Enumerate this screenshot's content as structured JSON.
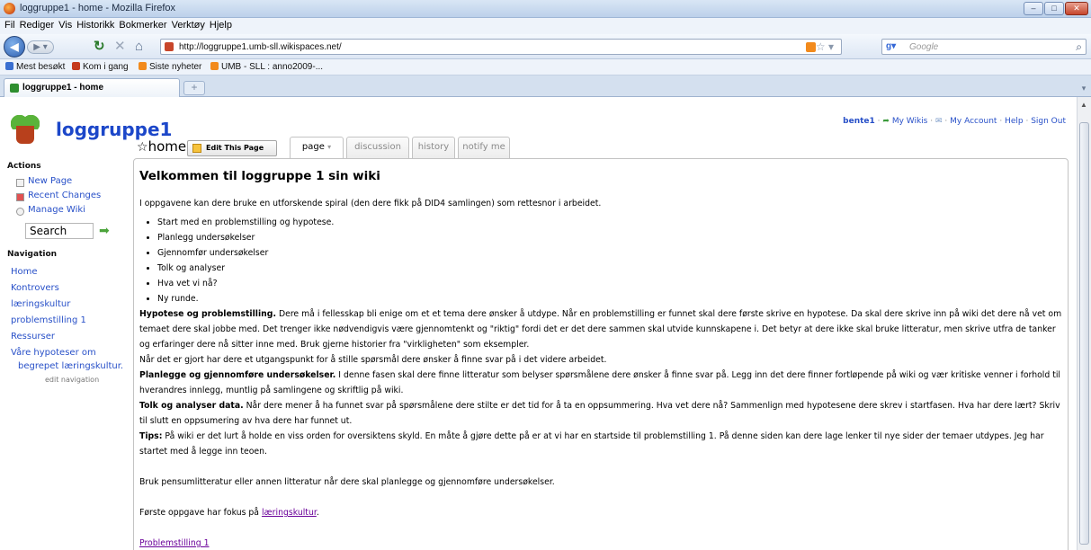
{
  "window": {
    "title": "loggruppe1 - home - Mozilla Firefox",
    "buttons": [
      "–",
      "□",
      "✕"
    ]
  },
  "menu": [
    "Fil",
    "Rediger",
    "Vis",
    "Historikk",
    "Bokmerker",
    "Verktøy",
    "Hjelp"
  ],
  "nav": {
    "url": "http://loggruppe1.umb-sll.wikispaces.net/",
    "search_placeholder": "Google"
  },
  "bookmarks": [
    {
      "label": "Mest besøkt",
      "color": "#3a6fd0"
    },
    {
      "label": "Kom i gang",
      "color": "#c5391c"
    },
    {
      "label": "Siste nyheter",
      "color": "#f28a1c"
    },
    {
      "label": "UMB - SLL : anno2009-...",
      "color": "#f28a1c"
    }
  ],
  "tab": {
    "label": "loggruppe1 - home"
  },
  "site": {
    "name": "loggruppe1",
    "user": "bente1",
    "userlinks": [
      "My Wikis",
      "My Account",
      "Help",
      "Sign Out"
    ]
  },
  "page": {
    "name": "home",
    "edit_label": "Edit This Page",
    "tabs": [
      "page",
      "discussion",
      "history",
      "notify me"
    ]
  },
  "sidebar": {
    "actions_heading": "Actions",
    "actions": [
      "New Page",
      "Recent Changes",
      "Manage Wiki"
    ],
    "search_label": "Search",
    "navigation_heading": "Navigation",
    "nav_links": [
      "Home",
      "Kontrovers",
      "læringskultur",
      "problemstilling 1",
      "Ressurser",
      "Våre hypoteser om",
      "begrepet læringskultur."
    ],
    "edit_navigation": "edit navigation"
  },
  "content": {
    "heading": "Velkommen til loggruppe 1 sin wiki",
    "intro": "I oppgavene kan dere bruke en utforskende spiral (den dere fikk på DID4 samlingen) som rettesnor i arbeidet.",
    "steps": [
      "Start med en problemstilling og hypotese.",
      "Planlegg undersøkelser",
      "Gjennomfør undersøkelser",
      "Tolk og analyser",
      "Hva vet vi nå?",
      "Ny runde."
    ],
    "hyp_label": "Hypotese og problemstilling.",
    "hyp_text": " Dere må i fellesskap bli enige om et et tema dere ønsker å utdype. Når en problemstilling er funnet skal dere første skrive en hypotese. Da skal dere skrive inn på wiki det dere nå vet om temaet dere skal jobbe med. Det trenger ikke nødvendigvis være gjennomtenkt og \"riktig\" fordi det er det dere sammen skal utvide kunnskapene i. Det betyr at dere ikke skal bruke litteratur, men skrive utfra de tanker og erfaringer dere nå sitter inne med. Bruk gjerne historier fra \"virkligheten\" som eksempler.",
    "hyp_after": "Når det er gjort har dere et utgangspunkt for å stille spørsmål dere ønsker å finne svar på i det videre arbeidet.",
    "plan_label": "Planlegge og gjennomføre undersøkelser.",
    "plan_text": " I denne fasen skal dere finne litteratur som belyser spørsmålene dere ønsker å finne svar på. Legg inn det dere finner fortløpende på wiki og vær kritiske venner i forhold til hverandres innlegg, muntlig på samlingene og skriftlig på wiki.",
    "tolk_label": "Tolk og analyser data.",
    "tolk_text": " Når dere mener å ha funnet svar på spørsmålene dere stilte er det tid for å ta en oppsummering. Hva vet dere nå? Sammenlign med hypotesene dere skrev i startfasen. Hva har dere lært? Skriv til slutt en oppsumering av hva dere har funnet ut.",
    "tips_label": "Tips:",
    "tips_text": " På wiki er det lurt å holde en viss orden for oversiktens skyld. En måte å gjøre dette på er at vi har en startside til problemstilling 1. På denne siden kan dere lage lenker til nye sider der temaer utdypes. Jeg har startet med å legge inn teoen.",
    "pensum": "Bruk pensumlitteratur eller annen litteratur når dere skal planlegge og gjennomføre undersøkelser.",
    "forste_prefix": "Første oppgave har fokus på ",
    "forste_link": "læringskultur",
    "forste_suffix": ".",
    "problem_link": "Problemstilling 1"
  }
}
